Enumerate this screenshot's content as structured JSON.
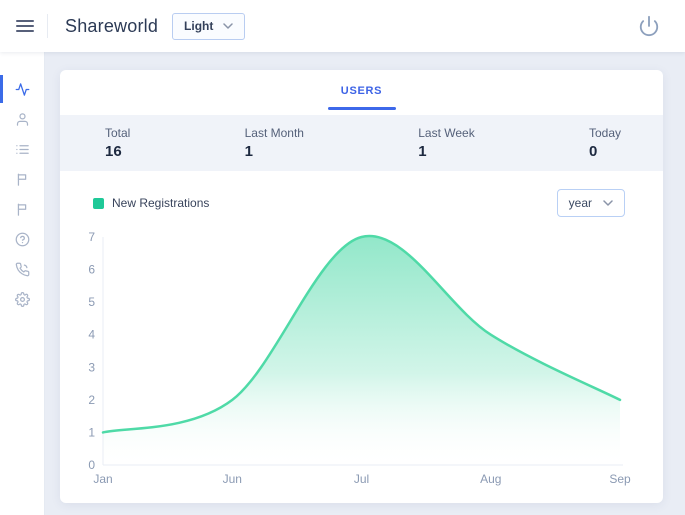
{
  "header": {
    "title": "Shareworld",
    "theme_select": {
      "value": "Light"
    }
  },
  "sidebar": {
    "items": [
      {
        "icon": "activity",
        "active": true
      },
      {
        "icon": "user",
        "active": false
      },
      {
        "icon": "list",
        "active": false
      },
      {
        "icon": "flag",
        "active": false
      },
      {
        "icon": "flag",
        "active": false
      },
      {
        "icon": "help",
        "active": false
      },
      {
        "icon": "phone",
        "active": false
      },
      {
        "icon": "settings",
        "active": false
      }
    ]
  },
  "tabs": [
    {
      "label": "USERS",
      "active": true
    }
  ],
  "stats": [
    {
      "label": "Total",
      "value": "16"
    },
    {
      "label": "Last Month",
      "value": "1"
    },
    {
      "label": "Last Week",
      "value": "1"
    },
    {
      "label": "Today",
      "value": "0"
    }
  ],
  "chart_controls": {
    "legend_label": "New Registrations",
    "legend_color": "#1fc998",
    "range_select_value": "year"
  },
  "chart_data": {
    "type": "area",
    "title": "",
    "xlabel": "",
    "ylabel": "",
    "categories": [
      "Jan",
      "Jun",
      "Jul",
      "Aug",
      "Sep"
    ],
    "series": [
      {
        "name": "New Registrations",
        "values": [
          1,
          2,
          7,
          4,
          2
        ]
      }
    ],
    "ylim": [
      0,
      7
    ],
    "yticks": [
      0,
      1,
      2,
      3,
      4,
      5,
      6,
      7
    ],
    "smooth": true,
    "grid": false,
    "legend_position": "top-left",
    "line_color": "#4fdaa7",
    "fill_gradient_top": "#7fe3c0",
    "fill_gradient_bottom": "#ffffff",
    "axis_color": "#e9edf4"
  },
  "colors": {
    "accent_blue": "#3d63e6",
    "accent_green": "#1fc998",
    "page_bg": "#e9edf5"
  }
}
